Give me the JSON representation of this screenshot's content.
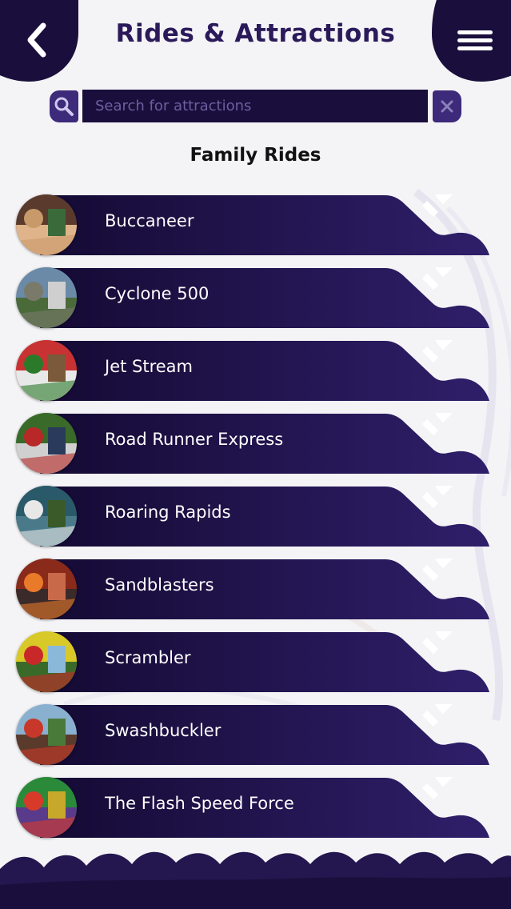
{
  "header": {
    "title": "Rides & Attractions",
    "back_icon": "chevron-left-icon",
    "menu_icon": "menu-icon"
  },
  "search": {
    "placeholder": "Search for attractions",
    "value": "",
    "search_icon": "search-icon",
    "clear_icon": "close-icon"
  },
  "section": {
    "heading": "Family Rides"
  },
  "rides": [
    {
      "label": "Buccaneer"
    },
    {
      "label": "Cyclone 500"
    },
    {
      "label": "Jet Stream"
    },
    {
      "label": "Road Runner Express"
    },
    {
      "label": "Roaring Rapids"
    },
    {
      "label": "Sandblasters"
    },
    {
      "label": "Scrambler"
    },
    {
      "label": "Swashbuckler"
    },
    {
      "label": "The Flash Speed Force"
    }
  ],
  "colors": {
    "primary_dark": "#1a0f3c",
    "primary": "#2b1a5a",
    "accent": "#3d2a7a",
    "background": "#f4f4f6"
  }
}
